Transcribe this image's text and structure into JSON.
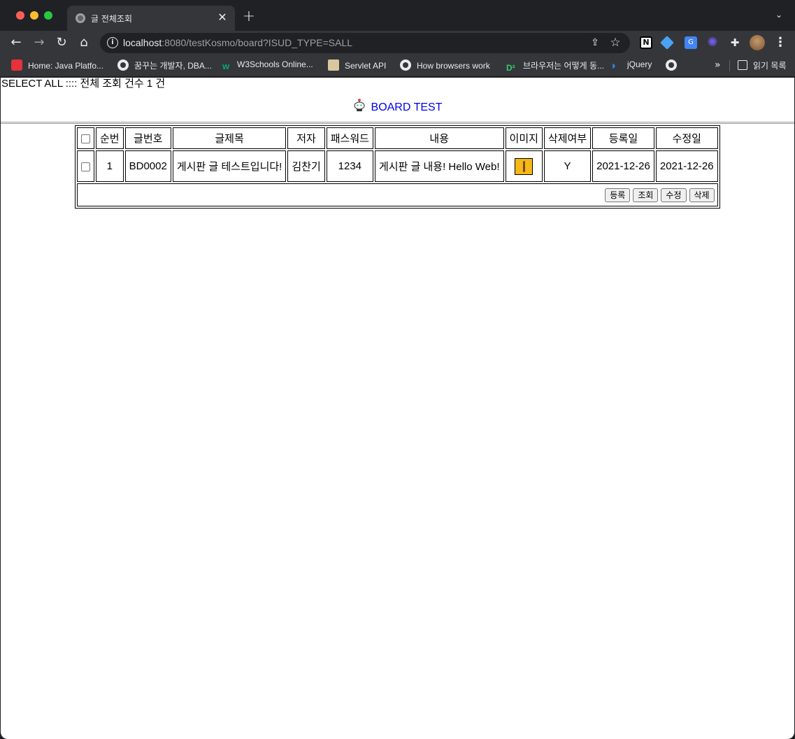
{
  "browser": {
    "tab": {
      "title": "글 전체조회"
    },
    "url": {
      "host": "localhost",
      "rest": ":8080/testKosmo/board?ISUD_TYPE=SALL"
    },
    "bookmarks": [
      {
        "label": "Home: Java Platfo...",
        "icon": "oracle-icon"
      },
      {
        "label": "꿈꾸는 개발자, DBA...",
        "icon": "globe-icon"
      },
      {
        "label": "W3Schools Online...",
        "icon": "w3schools-icon"
      },
      {
        "label": "Servlet API",
        "icon": "servlet-icon"
      },
      {
        "label": "How browsers work",
        "icon": "globe-icon"
      },
      {
        "label": "브라우저는 어떻게 동...",
        "icon": "d2-icon"
      },
      {
        "label": "jQuery",
        "icon": "jquery-icon"
      }
    ],
    "reading_list": "읽기 목록",
    "more_chevron": "»"
  },
  "page": {
    "summary": "SELECT ALL :::: 전체 조회 건수 1 건",
    "board_title": "BOARD TEST",
    "table": {
      "headers": [
        "순번",
        "글번호",
        "글제목",
        "저자",
        "패스워드",
        "내용",
        "이미지",
        "삭제여부",
        "등록일",
        "수정일"
      ],
      "rows": [
        {
          "seq": "1",
          "number": "BD0002",
          "subject": "게시판 글 테스트입니다!",
          "author": "김찬기",
          "password": "1234",
          "content": "게시판 글 내용! Hello Web!",
          "deleted": "Y",
          "created": "2021-12-26",
          "updated": "2021-12-26"
        }
      ]
    },
    "buttons": {
      "insert": "등록",
      "select": "조회",
      "update": "수정",
      "delete": "삭제"
    }
  }
}
